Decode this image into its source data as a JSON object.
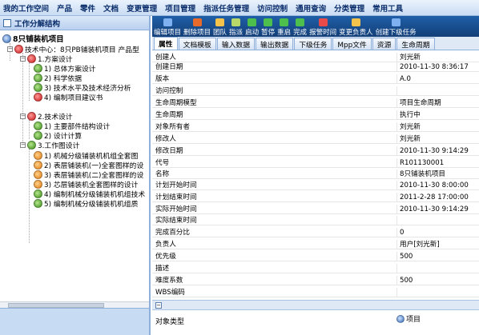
{
  "menu": [
    "我的工作空间",
    "产品",
    "零件",
    "文档",
    "变更管理",
    "项目管理",
    "指派任务管理",
    "访问控制",
    "通用查询",
    "分类管理",
    "常用工具"
  ],
  "left_panel": {
    "title": "工作分解结构",
    "tree": [
      {
        "label": "8只铺装机项目",
        "icon": "blue-project-icon"
      },
      {
        "label": "技术中心：8只PB铺装机项目  产品型",
        "icon": "red-gear-icon"
      },
      {
        "label": "1.方案设计",
        "icon": "red-gear-icon"
      },
      {
        "label": "1) 总体方案设计",
        "icon": "green-gear-icon"
      },
      {
        "label": "2) 科学依据",
        "icon": "green-gear-icon"
      },
      {
        "label": "3) 技术水平及技术经济分析",
        "icon": "green-gear-icon"
      },
      {
        "label": "4) 编制项目建议书",
        "icon": "red-gear-icon"
      },
      {
        "label": "2.技术设计",
        "icon": "red-gear-icon"
      },
      {
        "label": "1) 主要部件结构设计",
        "icon": "green-gear-icon"
      },
      {
        "label": "2) 设计计算",
        "icon": "green-gear-icon"
      },
      {
        "label": "3.工作图设计",
        "icon": "green-gear-icon"
      },
      {
        "label": "1) 机械分级铺装机机组全套图",
        "icon": "orange-gear-icon"
      },
      {
        "label": "2) 表层铺装机(一)全套图样的设",
        "icon": "orange-gear-icon"
      },
      {
        "label": "3) 表层铺装机(二)全套图样的设",
        "icon": "orange-gear-icon"
      },
      {
        "label": "3) 芯层铺装机全套图样的设计",
        "icon": "orange-gear-icon"
      },
      {
        "label": "4) 编制机械分级铺装机机组技术",
        "icon": "green-gear-icon"
      },
      {
        "label": "5) 编制机械分级铺装机机组质",
        "icon": "green-gear-icon"
      }
    ]
  },
  "toolbar": [
    "编辑项目",
    "删除项目",
    "团队",
    "指派",
    "启动",
    "暂停",
    "重启",
    "完成",
    "报警时间",
    "变更负责人",
    "创建下级任务"
  ],
  "tabs": [
    "属性",
    "文档模板",
    "输入数据",
    "输出数据",
    "下级任务",
    "Mpp文件",
    "资源",
    "生命周期"
  ],
  "properties": [
    {
      "k": "创建人",
      "v": "刘光新"
    },
    {
      "k": "创建日期",
      "v": "2010-11-30 8:36:17"
    },
    {
      "k": "版本",
      "v": "A.0"
    },
    {
      "k": "访问控制",
      "v": ""
    },
    {
      "k": "生命周期模型",
      "v": "项目生命周期"
    },
    {
      "k": "生命周期",
      "v": "执行中"
    },
    {
      "k": "对象所有者",
      "v": "刘光新"
    },
    {
      "k": "修改人",
      "v": "刘光新"
    },
    {
      "k": "修改日期",
      "v": "2010-11-30 9:14:29"
    },
    {
      "k": "代号",
      "v": "R101130001"
    },
    {
      "k": "名称",
      "v": "8只铺装机项目"
    },
    {
      "k": "计划开始时间",
      "v": "2010-11-30 8:00:00"
    },
    {
      "k": "计划结束时间",
      "v": "2011-2-28 17:00:00"
    },
    {
      "k": "实际开始时间",
      "v": "2010-11-30 9:14:29"
    },
    {
      "k": "实际结束时间",
      "v": ""
    },
    {
      "k": "完成百分比",
      "v": "0"
    },
    {
      "k": "负责人",
      "v": "用户[刘光新]"
    },
    {
      "k": "优先级",
      "v": "500"
    },
    {
      "k": "描述",
      "v": ""
    },
    {
      "k": "难度系数",
      "v": "500"
    },
    {
      "k": "WBS编码",
      "v": ""
    }
  ],
  "section": {
    "collapse_glyph": "−",
    "object_type_label": "对象类型",
    "object_type_value": "项目"
  },
  "colors": {
    "toolbar_bg": "#1f5fa8",
    "accent": "#0b2e6b"
  }
}
